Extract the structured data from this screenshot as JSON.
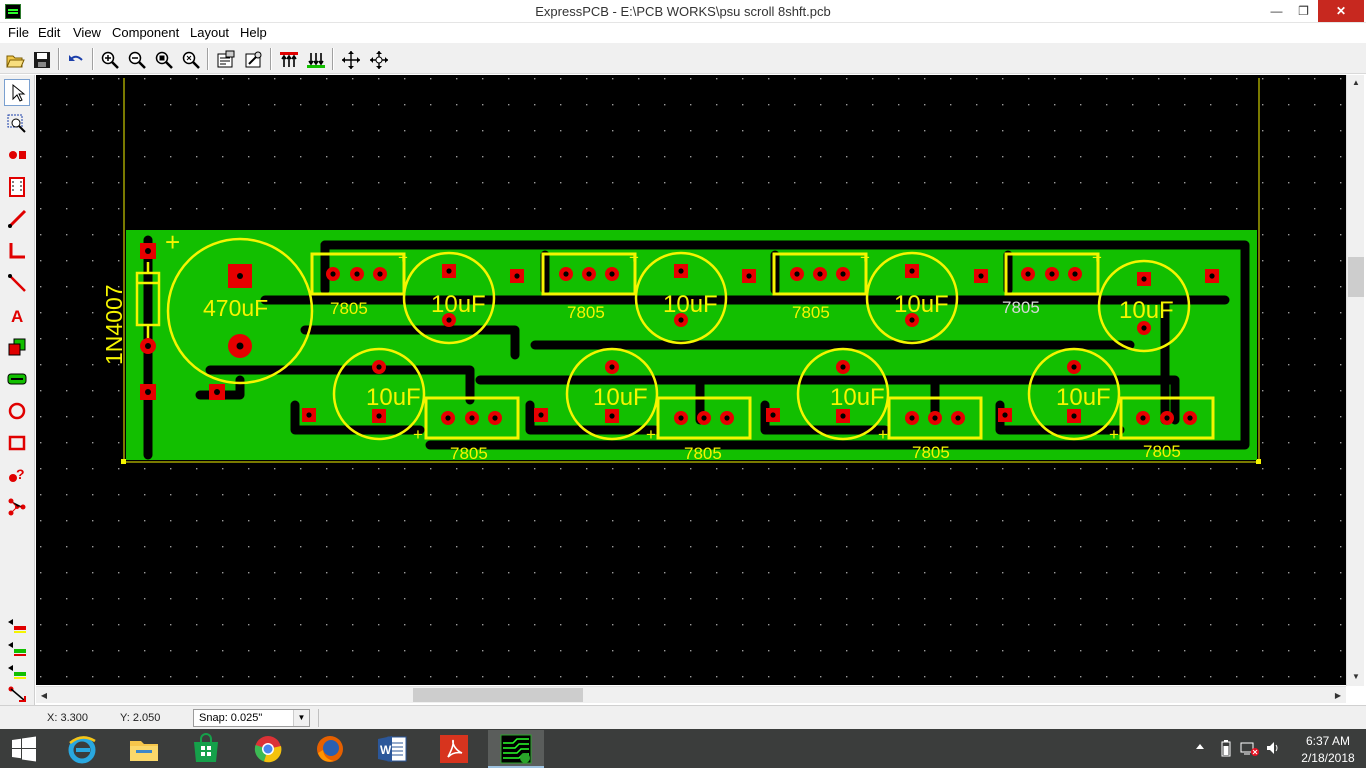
{
  "window": {
    "title": "ExpressPCB - E:\\PCB WORKS\\psu scroll 8shft.pcb",
    "controls": [
      "minimize",
      "restore",
      "close"
    ]
  },
  "menu": [
    "File",
    "Edit",
    "View",
    "Component",
    "Layout",
    "Help"
  ],
  "toolbar": {
    "buttons": [
      "open-icon",
      "save-icon",
      "undo-icon",
      "zoom-in-icon",
      "zoom-out-icon",
      "zoom-window-icon",
      "zoom-fit-icon",
      "properties-icon",
      "component-props-icon",
      "top-layer-icon",
      "bottom-layer-icon",
      "move-icon",
      "rotate-icon"
    ]
  },
  "palette": {
    "tools": [
      "select-tool",
      "zoom-select-tool",
      "pad-tool",
      "component-tool",
      "trace-tool",
      "corner-tool",
      "wire-tool",
      "text-tool",
      "filled-rect-tool",
      "ground-plane-tool",
      "circle-tool",
      "rectangle-tool",
      "query-tool",
      "net-tool"
    ],
    "layer_tools": [
      "layer-top-tool",
      "layer-bottom-tool",
      "layer-silk-tool",
      "layer-route-tool"
    ]
  },
  "pcb": {
    "labels": {
      "diode": "1N4007",
      "big_cap": "470uF",
      "small_cap": "10uF",
      "regulator": "7805",
      "plus": "+"
    },
    "colors": {
      "background": "#000000",
      "copper": "#12bf00",
      "silkscreen": "#f5f500",
      "pad": "#e60000",
      "grid_dot": "#9a9a9a",
      "trace": "#000000"
    }
  },
  "status": {
    "x": "X: 3.300",
    "y": "Y: 2.050",
    "snap": "Snap:  0.025\""
  },
  "taskbar": {
    "apps": [
      "start-icon",
      "internet-explorer-icon",
      "file-explorer-icon",
      "store-icon",
      "chrome-icon",
      "firefox-icon",
      "word-icon",
      "acrobat-icon",
      "expresspcb-icon"
    ],
    "time": "6:37 AM",
    "date": "2/18/2018"
  }
}
